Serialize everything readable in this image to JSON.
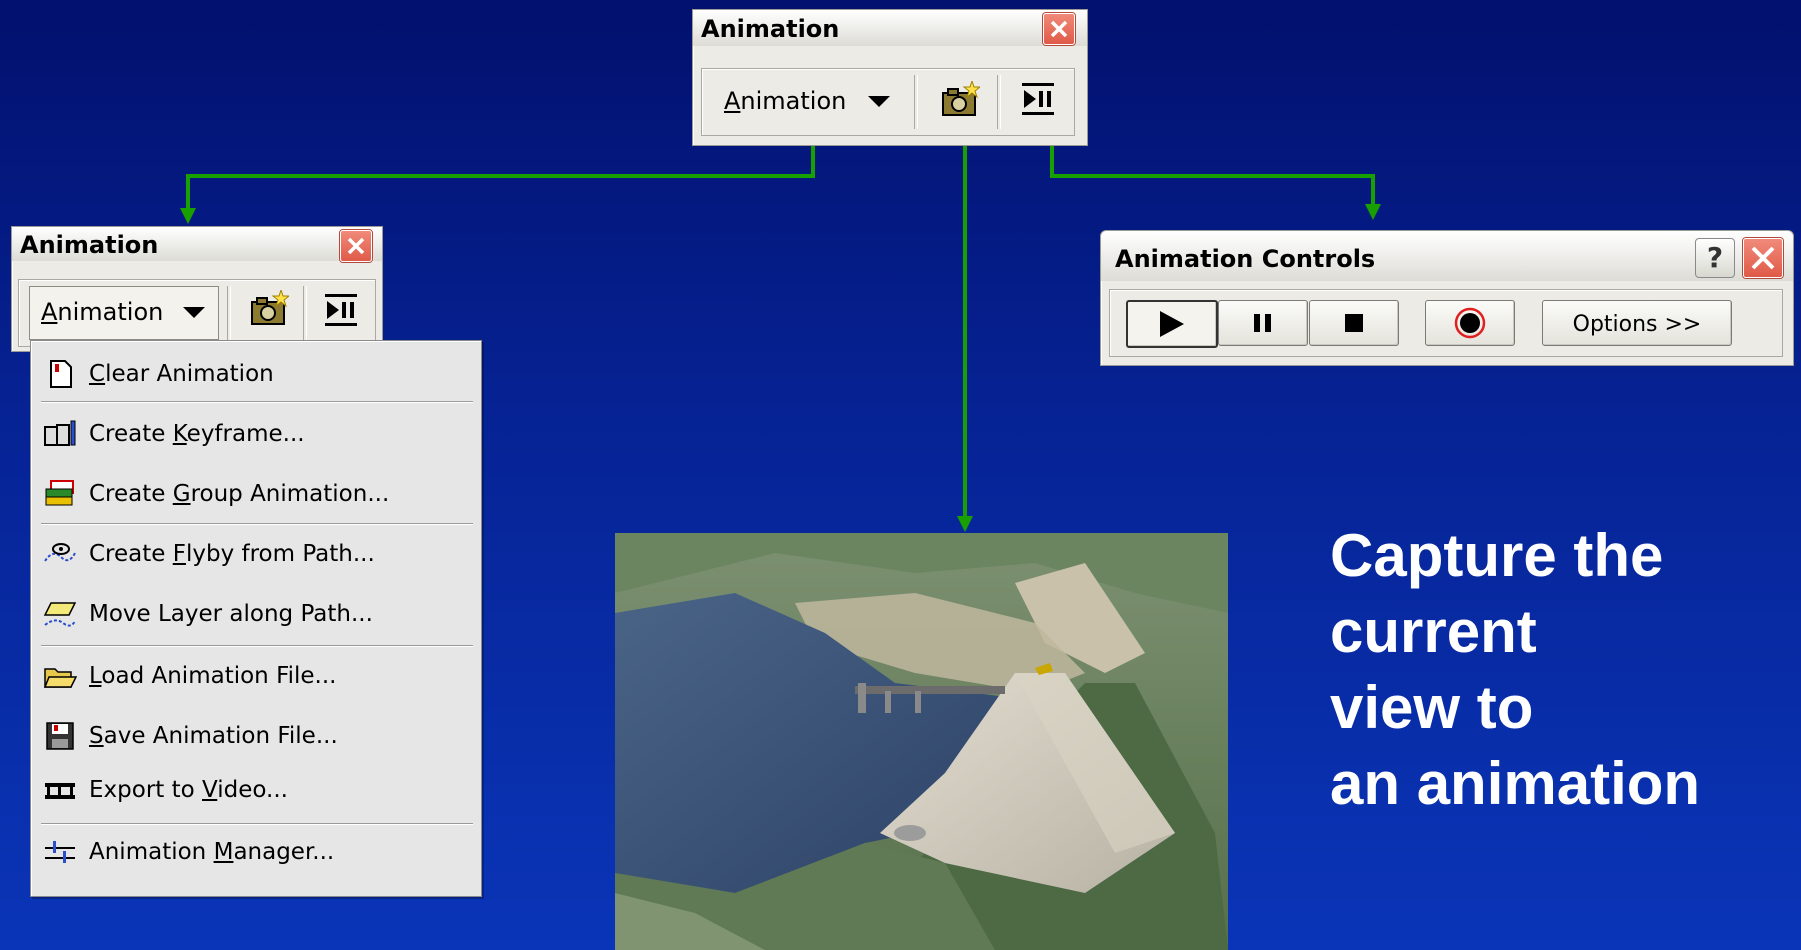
{
  "colors": {
    "background": "#0a2a9c",
    "connector": "#18a000",
    "window_face": "#ecebe6",
    "close_red": "#e05a48"
  },
  "animation_toolbar": {
    "title": "Animation",
    "dropdown_label_pre": "",
    "dropdown_label_access": "A",
    "dropdown_label_post": "nimation",
    "icons": [
      "camera-icon",
      "play-pause-icon"
    ]
  },
  "left_toolbar": {
    "title": "Animation",
    "dropdown_label_pre": "",
    "dropdown_label_access": "A",
    "dropdown_label_post": "nimation"
  },
  "menu": {
    "items": [
      {
        "pre": "",
        "key": "C",
        "post": "lear Animation",
        "icon": "clear-animation-icon"
      },
      {
        "pre": "Create ",
        "key": "K",
        "post": "eyframe...",
        "icon": "create-keyframe-icon"
      },
      {
        "pre": "Create ",
        "key": "G",
        "post": "roup Animation...",
        "icon": "group-animation-icon"
      },
      {
        "pre": "Create ",
        "key": "F",
        "post": "lyby from Path...",
        "icon": "flyby-icon"
      },
      {
        "pre": "Move Layer along Path...",
        "key": "",
        "post": "",
        "icon": "move-layer-path-icon"
      },
      {
        "pre": "",
        "key": "L",
        "post": "oad Animation File...",
        "icon": "open-folder-icon"
      },
      {
        "pre": "",
        "key": "S",
        "post": "ave Animation File...",
        "icon": "save-floppy-icon"
      },
      {
        "pre": "Export to ",
        "key": "V",
        "post": "ideo...",
        "icon": "film-strip-icon"
      },
      {
        "pre": "Animation ",
        "key": "M",
        "post": "anager...",
        "icon": "animation-manager-icon"
      }
    ]
  },
  "controls": {
    "title": "Animation Controls",
    "help": "?",
    "options_label": "Options >>",
    "buttons": [
      "play-icon",
      "pause-icon",
      "stop-icon",
      "record-icon"
    ]
  },
  "caption": {
    "lines": [
      "Capture the",
      "current",
      "view to",
      "an animation"
    ]
  },
  "scene": {
    "description_icon": "dam-reservoir-3d-view"
  }
}
